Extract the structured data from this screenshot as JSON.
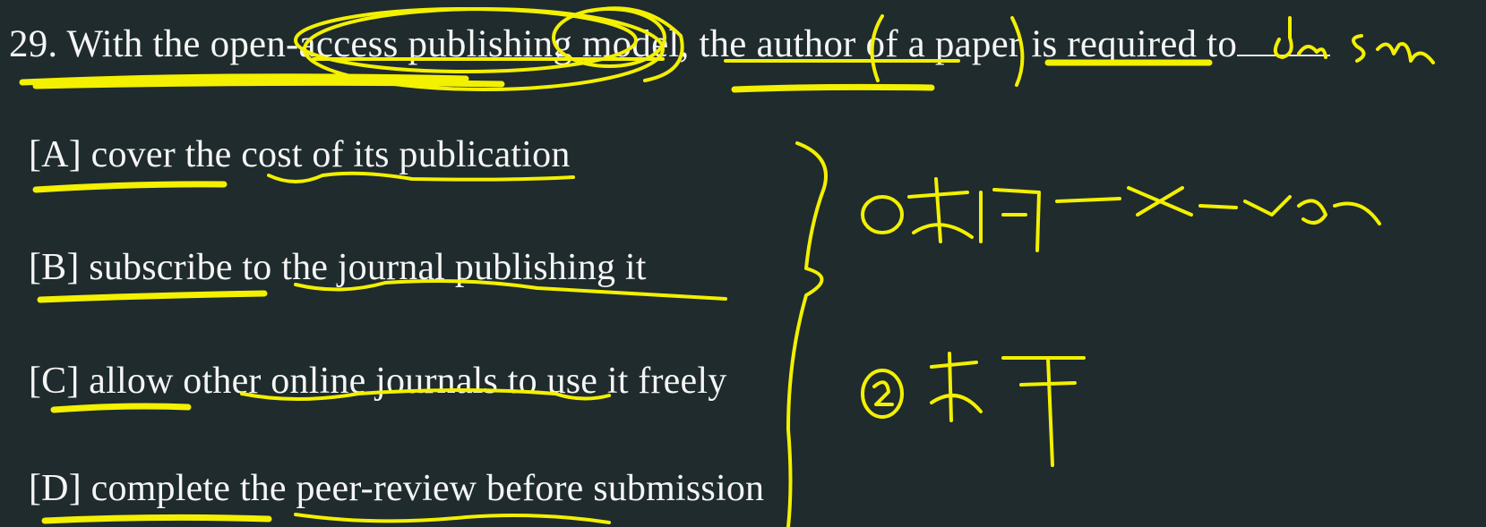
{
  "question": {
    "number": "29.",
    "text": "With the open-access publishing model, the author of a paper is required to"
  },
  "options": [
    {
      "letter": "[A]",
      "text": "cover the cost of its publication"
    },
    {
      "letter": "[B]",
      "text": "subscribe to the journal publishing it"
    },
    {
      "letter": "[C]",
      "text": "allow other online journals to use it freely"
    },
    {
      "letter": "[D]",
      "text": "complete the peer-review before submission"
    }
  ],
  "annotation_color": "#f3f000",
  "background_color": "#1f2b2d"
}
